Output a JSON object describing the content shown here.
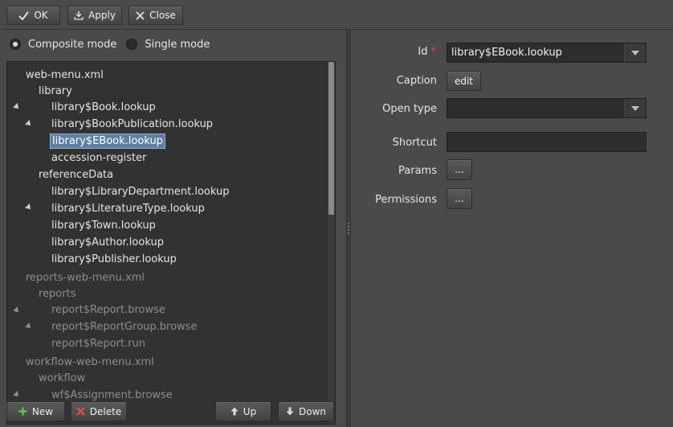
{
  "toolbar": {
    "ok_label": "OK",
    "apply_label": "Apply",
    "close_label": "Close"
  },
  "mode": {
    "composite_label": "Composite mode",
    "single_label": "Single mode",
    "selected": "composite"
  },
  "tree": {
    "files": [
      {
        "name": "web-menu.xml",
        "menus": [
          {
            "name": "library",
            "items": [
              "library$Book.lookup",
              "library$BookPublication.lookup",
              "library$EBook.lookup",
              "accession-register"
            ]
          },
          {
            "name": "referenceData",
            "items": [
              "library$LibraryDepartment.lookup",
              "library$LiteratureType.lookup",
              "library$Town.lookup",
              "library$Author.lookup",
              "library$Publisher.lookup"
            ]
          }
        ]
      },
      {
        "name": "reports-web-menu.xml",
        "menus": [
          {
            "name": "reports",
            "items": [
              "report$Report.browse",
              "report$ReportGroup.browse",
              "report$Report.run"
            ]
          }
        ]
      },
      {
        "name": "workflow-web-menu.xml",
        "menus": [
          {
            "name": "workflow",
            "items": [
              "wf$Assignment.browse"
            ]
          }
        ]
      }
    ],
    "selected_item": "library$EBook.lookup"
  },
  "bottom_buttons": {
    "new_label": "New",
    "delete_label": "Delete",
    "up_label": "Up",
    "down_label": "Down"
  },
  "form": {
    "id_label": "Id",
    "id_value": "library$EBook.lookup",
    "caption_label": "Caption",
    "caption_button": "edit",
    "open_type_label": "Open type",
    "open_type_value": "",
    "shortcut_label": "Shortcut",
    "shortcut_value": "",
    "params_label": "Params",
    "params_button": "...",
    "permissions_label": "Permissions",
    "permissions_button": "..."
  },
  "colors": {
    "background": "#4a4a4a",
    "tree_background": "#323232",
    "selection": "#5c7fa3",
    "required_marker": "#e04a4a",
    "new_icon": "#5cc44a",
    "delete_icon": "#e24a4a"
  }
}
